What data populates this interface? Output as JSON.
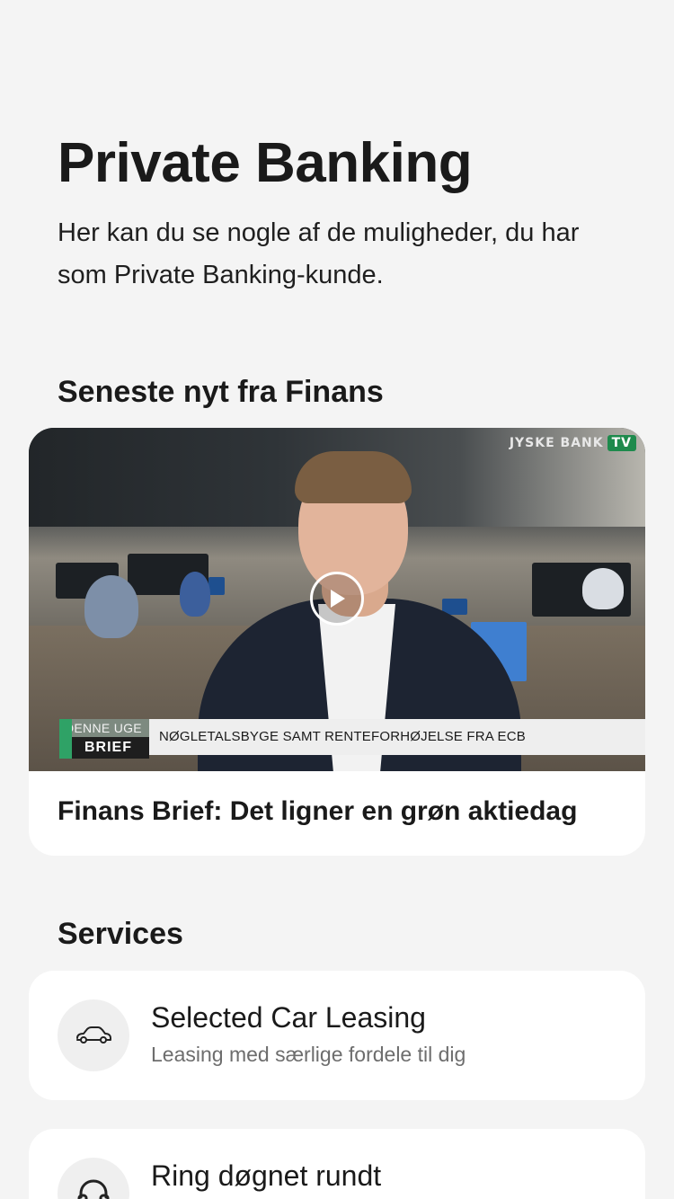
{
  "header": {
    "title": "Private Banking",
    "subtitle": "Her kan du se nogle af de muligheder, du har som Private Banking-kunde."
  },
  "news": {
    "heading": "Seneste nyt fra Finans",
    "video": {
      "brand": "JYSKE BANK",
      "brand_tv": "TV",
      "badge_top": "DENNE UGE",
      "badge_bottom": "BRIEF",
      "headline": "NØGLETALSBYGE SAMT RENTEFORHØJELSE FRA ECB",
      "play_icon": "play-icon"
    },
    "caption": "Finans Brief: Det ligner en grøn aktiedag"
  },
  "services": {
    "heading": "Services",
    "items": [
      {
        "title": "Selected Car Leasing",
        "description": "Leasing med særlige fordele til dig",
        "icon": "car-icon"
      },
      {
        "title": "Ring døgnet rundt",
        "description": "",
        "icon": "headset-icon"
      }
    ]
  },
  "colors": {
    "background": "#f4f4f4",
    "card": "#ffffff",
    "brand_green": "#2fa266",
    "text": "#1a1a1a",
    "muted_text": "#6d6d6d"
  }
}
